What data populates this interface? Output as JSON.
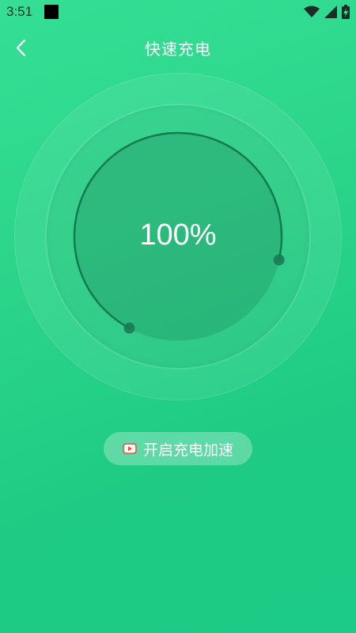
{
  "status_bar": {
    "time": "3:51",
    "icons": [
      "wifi-icon",
      "signal-icon",
      "battery-charging-icon"
    ]
  },
  "header": {
    "back_icon": "chevron-left-icon",
    "title": "快速充电"
  },
  "gauge": {
    "percent_text": "100%",
    "level": 1.0
  },
  "boost_button": {
    "icon": "video-play-icon",
    "label": "开启充电加速"
  },
  "colors": {
    "background_top": "#34df95",
    "background_bottom": "#1ccb86",
    "arc": "#137a52"
  }
}
